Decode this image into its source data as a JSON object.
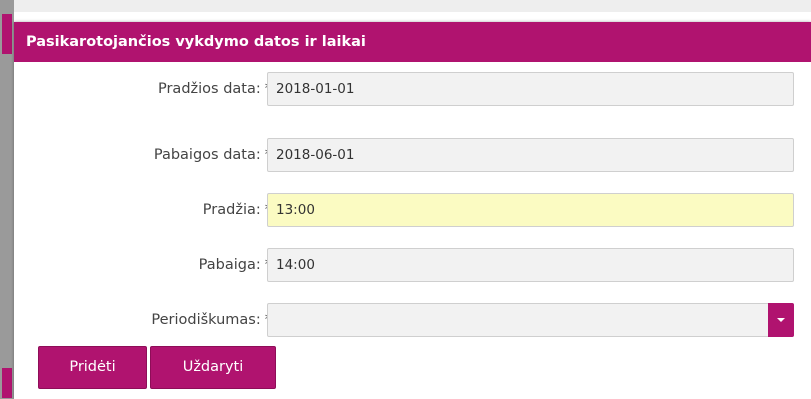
{
  "dialog": {
    "title": "Pasikarotojančios vykdymo datos ir laikai",
    "header_color": "#b0136f"
  },
  "form": {
    "required_marker": "*",
    "fields": [
      {
        "label": "Pradžios data:",
        "value": "2018-01-01"
      },
      {
        "label": "Pabaigos data:",
        "value": "2018-06-01"
      },
      {
        "label": "Pradžia:",
        "value": "13:00"
      },
      {
        "label": "Pabaiga:",
        "value": "14:00"
      }
    ],
    "periodicity": {
      "label": "Periodiškumas:",
      "value": ""
    }
  },
  "buttons": {
    "add_label": "Pridėti",
    "close_label": "Uždaryti"
  },
  "colors": {
    "accent": "#b0136f",
    "focused_input_bg": "#fbfbc2",
    "input_bg": "#f2f2f2"
  }
}
